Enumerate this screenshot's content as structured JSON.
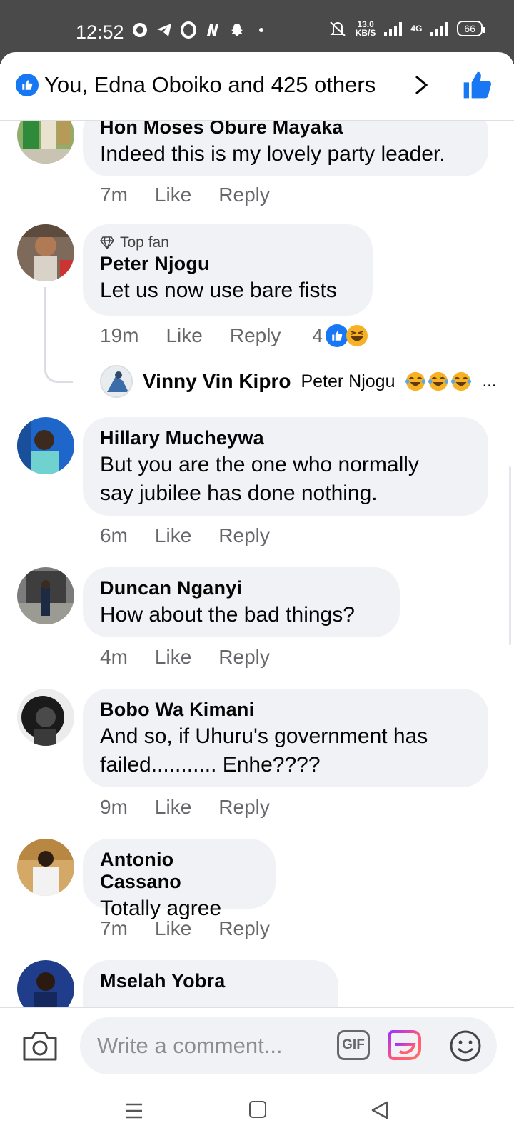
{
  "status_bar": {
    "time": "12:52",
    "app_icons": [
      "whatsapp-icon",
      "telegram-icon",
      "opera-icon",
      "n-icon",
      "snapchat-icon",
      "dot"
    ],
    "net_speed_value": "13.0",
    "net_speed_unit": "KB/S",
    "network_label": "4G",
    "battery": "66"
  },
  "header": {
    "reactions_summary": "You, Edna Oboiko and 425 others"
  },
  "comments": [
    {
      "name": "Hon Moses Obure Mayaka",
      "text": "Indeed this is my lovely party leader.",
      "time": "7m",
      "like": "Like",
      "reply": "Reply"
    },
    {
      "badge": "Top fan",
      "name": "Peter Njogu",
      "text": "Let us now use bare fists",
      "time": "19m",
      "like": "Like",
      "reply": "Reply",
      "reaction_count": "4",
      "reply_preview": {
        "name": "Vinny Vin Kipro",
        "mention": "Peter Njogu",
        "ellipsis": "..."
      }
    },
    {
      "name": "Hillary Mucheywa",
      "text_line1": "But you are the one who normally",
      "text_line2": "say jubilee has done nothing.",
      "time": "6m",
      "like": "Like",
      "reply": "Reply"
    },
    {
      "name": "Duncan Nganyi",
      "text": "How about the bad things?",
      "time": "4m",
      "like": "Like",
      "reply": "Reply"
    },
    {
      "name": "Bobo Wa Kimani",
      "text_line1": "And so, if Uhuru's government has",
      "text_line2": "failed........... Enhe????",
      "time": "9m",
      "like": "Like",
      "reply": "Reply"
    },
    {
      "name": "Antonio Cassano",
      "text": "Totally agree",
      "time": "7m",
      "like": "Like",
      "reply": "Reply"
    },
    {
      "name": "Mselah Yobra"
    }
  ],
  "composer": {
    "placeholder": "Write a comment...",
    "gif_label": "GIF"
  },
  "colors": {
    "brand_blue": "#1877f2",
    "bubble_bg": "#f0f2f5",
    "meta_text": "#65676b"
  }
}
